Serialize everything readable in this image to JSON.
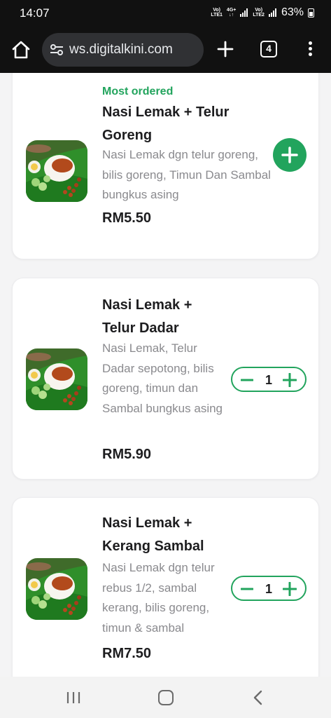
{
  "status_bar": {
    "time": "14:07",
    "net1_label_top": "Vo)",
    "net1_label_bottom": "LTE1",
    "net_type": "4G+",
    "net2_label_top": "Vo)",
    "net2_label_bottom": "LTE2",
    "battery": "63%"
  },
  "browser": {
    "url": "ws.digitalkini.com",
    "tab_count": "4",
    "icons": [
      "home-icon",
      "site-settings-icon",
      "plus-icon",
      "tab-switcher-icon",
      "more-vert-icon"
    ]
  },
  "menu": {
    "items": [
      {
        "tag": "Most ordered",
        "name": "Nasi Lemak + Telur Goreng",
        "description": "Nasi Lemak dgn telur goreng, bilis goreng, Timun Dan Sambal bungkus asing",
        "price": "RM5.50",
        "action": "add"
      },
      {
        "name": "Nasi Lemak + Telur Dadar",
        "description": "Nasi Lemak, Telur Dadar sepotong, bilis goreng, timun dan Sambal bungkus asing",
        "price": "RM5.90",
        "quantity": "1"
      },
      {
        "name": "Nasi Lemak + Kerang Sambal",
        "description": "Nasi Lemak dgn telur rebus 1/2, sambal kerang, bilis goreng, timun & sambal",
        "price": "RM7.50",
        "quantity": "1"
      }
    ]
  },
  "colors": {
    "accent": "#22a45d",
    "text": "#1d1d1f",
    "muted": "#8a8a8e",
    "chrome": "#111111"
  },
  "nav_bar": {
    "icons": [
      "recents-icon",
      "home-icon",
      "back-icon"
    ]
  }
}
